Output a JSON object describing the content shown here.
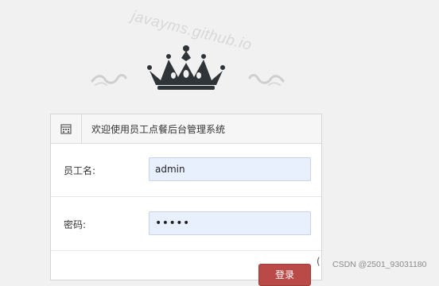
{
  "watermark": {
    "top_text": "javayms.github.io",
    "bottom_text": "CSDN @2501_93031180"
  },
  "decor": {
    "crown": "crown-icon",
    "swirls": "swirl-ornament-icon"
  },
  "panel": {
    "header_icon": "building-icon",
    "title": "欢迎使用员工点餐后台管理系统"
  },
  "form": {
    "username_label": "员工名:",
    "username_value": "admin",
    "password_label": "密码:",
    "password_value": "•••••",
    "submit_label": "登录"
  },
  "side_glyph": "(",
  "colors": {
    "accent": "#b94a48",
    "input_bg": "#e8f0fe",
    "page_bg": "#f1f1f1"
  }
}
